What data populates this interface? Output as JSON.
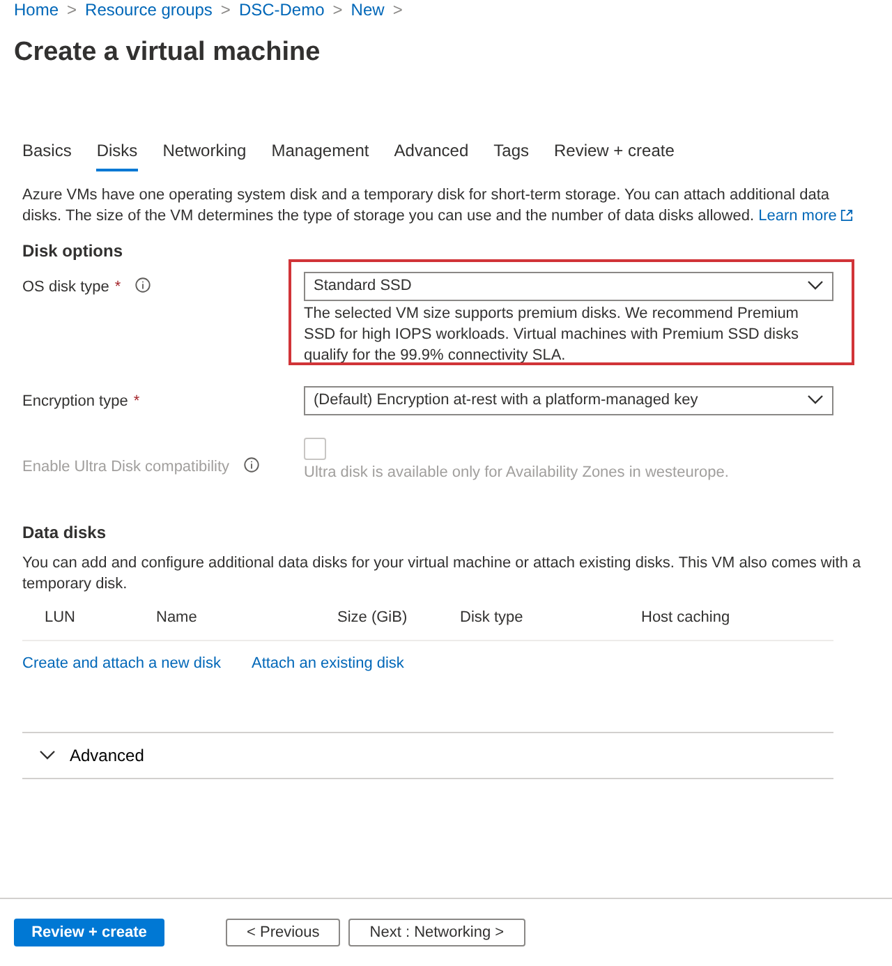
{
  "breadcrumb": [
    {
      "label": "Home"
    },
    {
      "label": "Resource groups"
    },
    {
      "label": "DSC-Demo"
    },
    {
      "label": "New"
    }
  ],
  "breadcrumb_separator": ">",
  "title": "Create a virtual machine",
  "tabs": [
    {
      "label": "Basics",
      "selected": false
    },
    {
      "label": "Disks",
      "selected": true
    },
    {
      "label": "Networking",
      "selected": false
    },
    {
      "label": "Management",
      "selected": false
    },
    {
      "label": "Advanced",
      "selected": false
    },
    {
      "label": "Tags",
      "selected": false
    },
    {
      "label": "Review + create",
      "selected": false
    }
  ],
  "intro": {
    "text": "Azure VMs have one operating system disk and a temporary disk for short-term storage. You can attach additional data disks. The size of the VM determines the type of storage you can use and the number of data disks allowed.",
    "link": "Learn more"
  },
  "disk_options": {
    "heading": "Disk options",
    "fields": [
      {
        "kind": "select",
        "label": "OS disk type",
        "required_mark": "*",
        "info": true,
        "disabled": false,
        "highlighted": true,
        "value": "Standard SSD",
        "note": "The selected VM size supports premium disks. We recommend Premium SSD for high IOPS workloads. Virtual machines with Premium SSD disks qualify for the 99.9% connectivity SLA."
      },
      {
        "kind": "select",
        "label": "Encryption type",
        "required_mark": "*",
        "info": false,
        "disabled": false,
        "highlighted": false,
        "value": "(Default) Encryption at-rest with a platform-managed key"
      },
      {
        "kind": "checkbox",
        "label": "Enable Ultra Disk compatibility",
        "info": true,
        "disabled": true,
        "highlighted": false,
        "checked": false,
        "note": "Ultra disk is available only for Availability Zones in westeurope."
      }
    ]
  },
  "data_disks": {
    "heading": "Data disks",
    "text": "You can add and configure additional data disks for your virtual machine or attach existing disks. This VM also comes with a temporary disk.",
    "table": {
      "columns": [
        "LUN",
        "Name",
        "Size (GiB)",
        "Disk type",
        "Host caching"
      ]
    },
    "links": [
      "Create and attach a new disk",
      "Attach an existing disk"
    ]
  },
  "advanced_section": {
    "label": "Advanced",
    "expanded": false
  },
  "footer": {
    "buttons": [
      {
        "kind": "primary",
        "label": "Review + create"
      },
      {
        "kind": "secondary",
        "label": "< Previous"
      },
      {
        "kind": "secondary",
        "label": "Next : Networking >"
      }
    ]
  }
}
